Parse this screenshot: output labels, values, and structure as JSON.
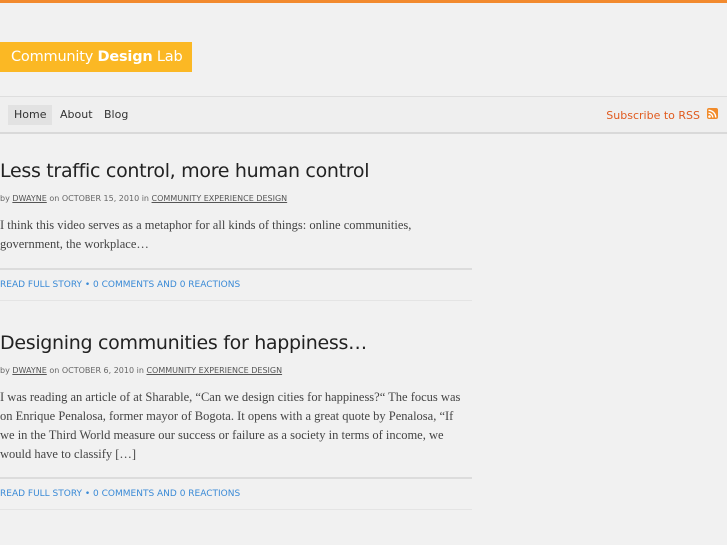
{
  "header": {
    "logo_part1": "Community ",
    "logo_part2": "Design",
    "logo_part3": " Lab"
  },
  "nav": {
    "items": [
      {
        "label": "Home"
      },
      {
        "label": "About"
      },
      {
        "label": "Blog"
      }
    ],
    "rss_label": "Subscribe to RSS"
  },
  "posts": [
    {
      "title": "Less traffic control, more human control",
      "by": "by ",
      "author": "DWAYNE",
      "on": " on OCTOBER 15, 2010 in ",
      "category": "COMMUNITY EXPERIENCE DESIGN",
      "excerpt": "I think this video serves as a metaphor for all kinds of things: online communities, government, the workplace…",
      "read_more": "READ FULL STORY",
      "bullet": " • ",
      "comments": "0 COMMENTS AND 0 REACTIONS"
    },
    {
      "title": "Designing communities for happiness…",
      "by": "by ",
      "author": "DWAYNE",
      "on": " on OCTOBER 6, 2010 in ",
      "category": "COMMUNITY EXPERIENCE DESIGN",
      "excerpt": "I was reading an article of at Sharable, “Can we design cities for happiness?“ The focus was on Enrique Penalosa, former mayor of Bogota. It opens with a great quote by Penalosa, “If we in the Third World measure our success or failure as a society in terms of income, we would have to classify […]",
      "read_more": "READ FULL STORY",
      "bullet": " • ",
      "comments": "0 COMMENTS AND 0 REACTIONS"
    }
  ],
  "colors": {
    "accent_orange": "#f28a2e",
    "logo_bg": "#fbb824",
    "link_blue": "#3a8ad6"
  }
}
